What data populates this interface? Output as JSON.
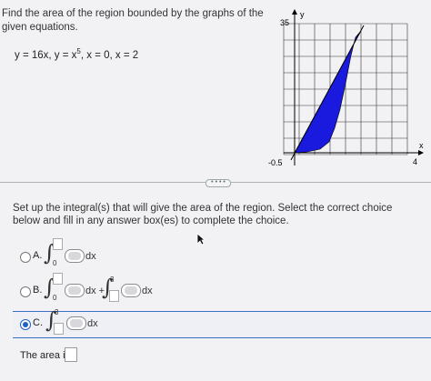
{
  "problem": {
    "prompt": "Find the area of the region bounded by the graphs of the given equations.",
    "equation": {
      "y1": "y = 16x, y = x",
      "exponent": "5",
      "rest": ", x = 0, x = 2"
    }
  },
  "graph": {
    "axis_y_label": "y",
    "axis_x_label": "x",
    "y_max_label": "35",
    "x_min_label": "-0.5",
    "x_max_label": "4",
    "region_color": "#1a1adf"
  },
  "instructions": "Set up the integral(s) that will give the area of the region. Select the correct choice below and fill in any answer box(es) to complete the choice.",
  "choices": [
    {
      "letter": "A.",
      "lower": "0",
      "dx": "dx"
    },
    {
      "letter": "B.",
      "lower": "0",
      "dx1": "dx +",
      "upper2": "3",
      "dx2": "dx"
    },
    {
      "letter": "C.",
      "upper": "3",
      "dx": "dx"
    }
  ],
  "area": {
    "label": "The area is"
  },
  "colors": {
    "accent": "#1f63c4"
  }
}
